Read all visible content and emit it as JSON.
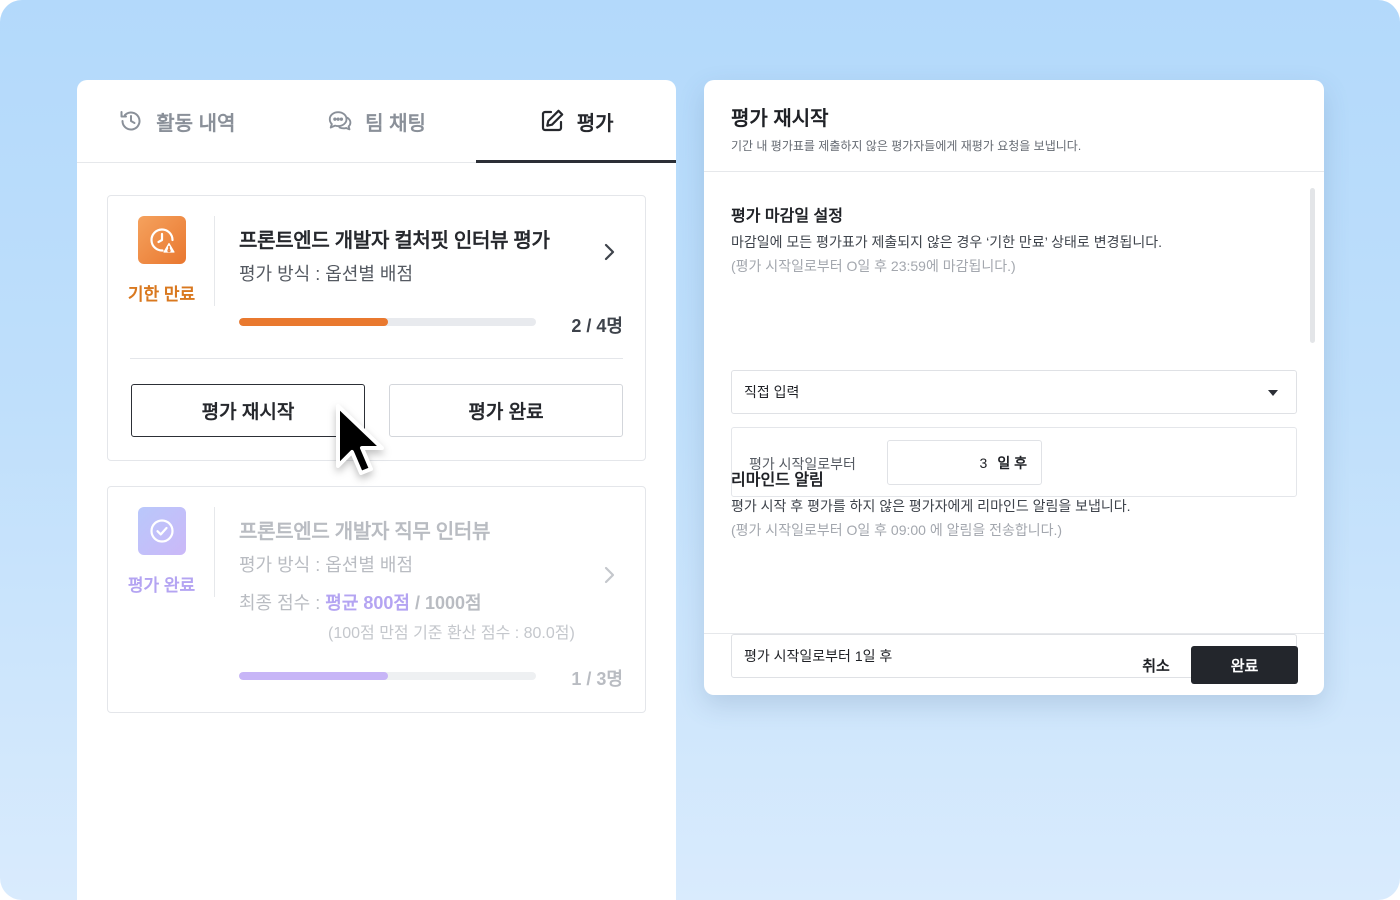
{
  "tabs": [
    {
      "label": "활동 내역",
      "icon": "history-icon"
    },
    {
      "label": "팀 채팅",
      "icon": "chat-icon"
    },
    {
      "label": "평가",
      "icon": "edit-icon",
      "active": true
    }
  ],
  "cards": [
    {
      "status": "기한 만료",
      "status_icon": "clock-warning-icon",
      "title": "프론트엔드 개발자 컬처핏 인터뷰 평가",
      "method": "평가 방식 : 옵션별 배점",
      "progress": 0.5,
      "count": "2 / 4명",
      "buttons": {
        "restart": "평가 재시작",
        "complete": "평가 완료"
      }
    },
    {
      "status": "평가 완료",
      "status_icon": "check-circle-icon",
      "title": "프론트엔드 개발자 직무 인터뷰",
      "method": "평가 방식 : 옵션별 배점",
      "score_label": "최종 점수 :",
      "score_avg": "평균 800점",
      "score_total": "/ 1000점",
      "score_note": "(100점 만점 기준 환산 점수 : 80.0점)",
      "progress": 0.5,
      "count": "1 / 3명"
    }
  ],
  "dialog": {
    "title": "평가 재시작",
    "subtitle": "기간 내 평가표를 제출하지 않은 평가자들에게 재평가 요청을 보냅니다.",
    "deadline": {
      "title": "평가 마감일 설정",
      "desc": "마감일에 모든 평가표가 제출되지 않은 경우 ‘기한 만료’ 상태로 변경됩니다.",
      "note": "(평가 시작일로부터 O일 후 23:59에 마감됩니다.)",
      "select_value": "직접 입력",
      "days_label": "평가 시작일로부터",
      "days_value": "3",
      "days_unit": "일 후"
    },
    "reminder": {
      "title": "리마인드 알림",
      "desc": "평가 시작 후 평가를 하지 않은 평가자에게 리마인드 알림을 보냅니다.",
      "note": "(평가 시작일로부터 O일 후 09:00 에 알림을 전송합니다.)",
      "select_value": "평가 시작일로부터 1일 후"
    },
    "cancel_label": "취소",
    "done_label": "완료"
  },
  "colors": {
    "accent_orange": "#e9792f",
    "accent_purple": "#c7b5f7",
    "dark": "#23262c"
  }
}
